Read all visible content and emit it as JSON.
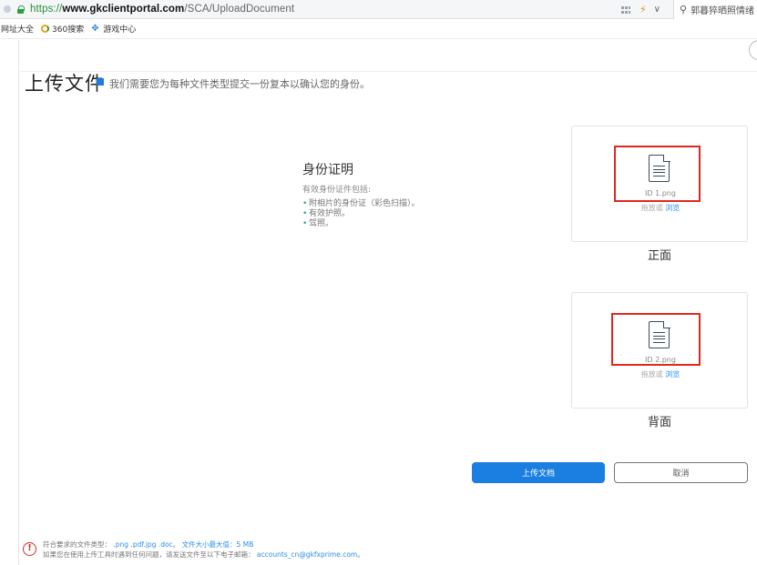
{
  "browser": {
    "url_scheme": "https://",
    "url_host": "www.gkclientportal.com",
    "url_path": "/SCA/UploadDocument",
    "search_text": "郭暮猝晒照情绪"
  },
  "bookmarks": [
    {
      "label": "网址大全"
    },
    {
      "label": "360搜索"
    },
    {
      "label": "游戏中心"
    }
  ],
  "page": {
    "title": "上传文件",
    "description": "我们需要您为每种文件类型提交一份复本以确认您的身份。",
    "id_section": {
      "title": "身份证明",
      "subtitle": "有效身份证件包括:",
      "items": [
        "附相片的身份证（彩色扫描）。",
        "有效护照。",
        "驾照。"
      ]
    },
    "front_card": {
      "file_name": "ID 1.png",
      "drop_text": "拖放或",
      "browse_text": "浏览",
      "label": "正面"
    },
    "back_card": {
      "file_name": "ID 2.png",
      "drop_text": "拖放或",
      "browse_text": "浏览",
      "label": "背面"
    },
    "buttons": {
      "upload": "上传文档",
      "cancel": "取消"
    },
    "footer": {
      "line1_prefix": "符合要求的文件类型：",
      "line1_types": ".png .pdf.jpg .doc。",
      "line1_size": "文件大小最大值：5 MB",
      "line2_prefix": "如果您在使用上传工具时遇到任何问题，请发送文件至以下电子邮箱：",
      "email": "accounts_cn@gkfxprime.com",
      "line2_suffix": "。"
    }
  },
  "colors": {
    "accent": "#1a7fe0",
    "highlight_box": "#e0281e"
  }
}
